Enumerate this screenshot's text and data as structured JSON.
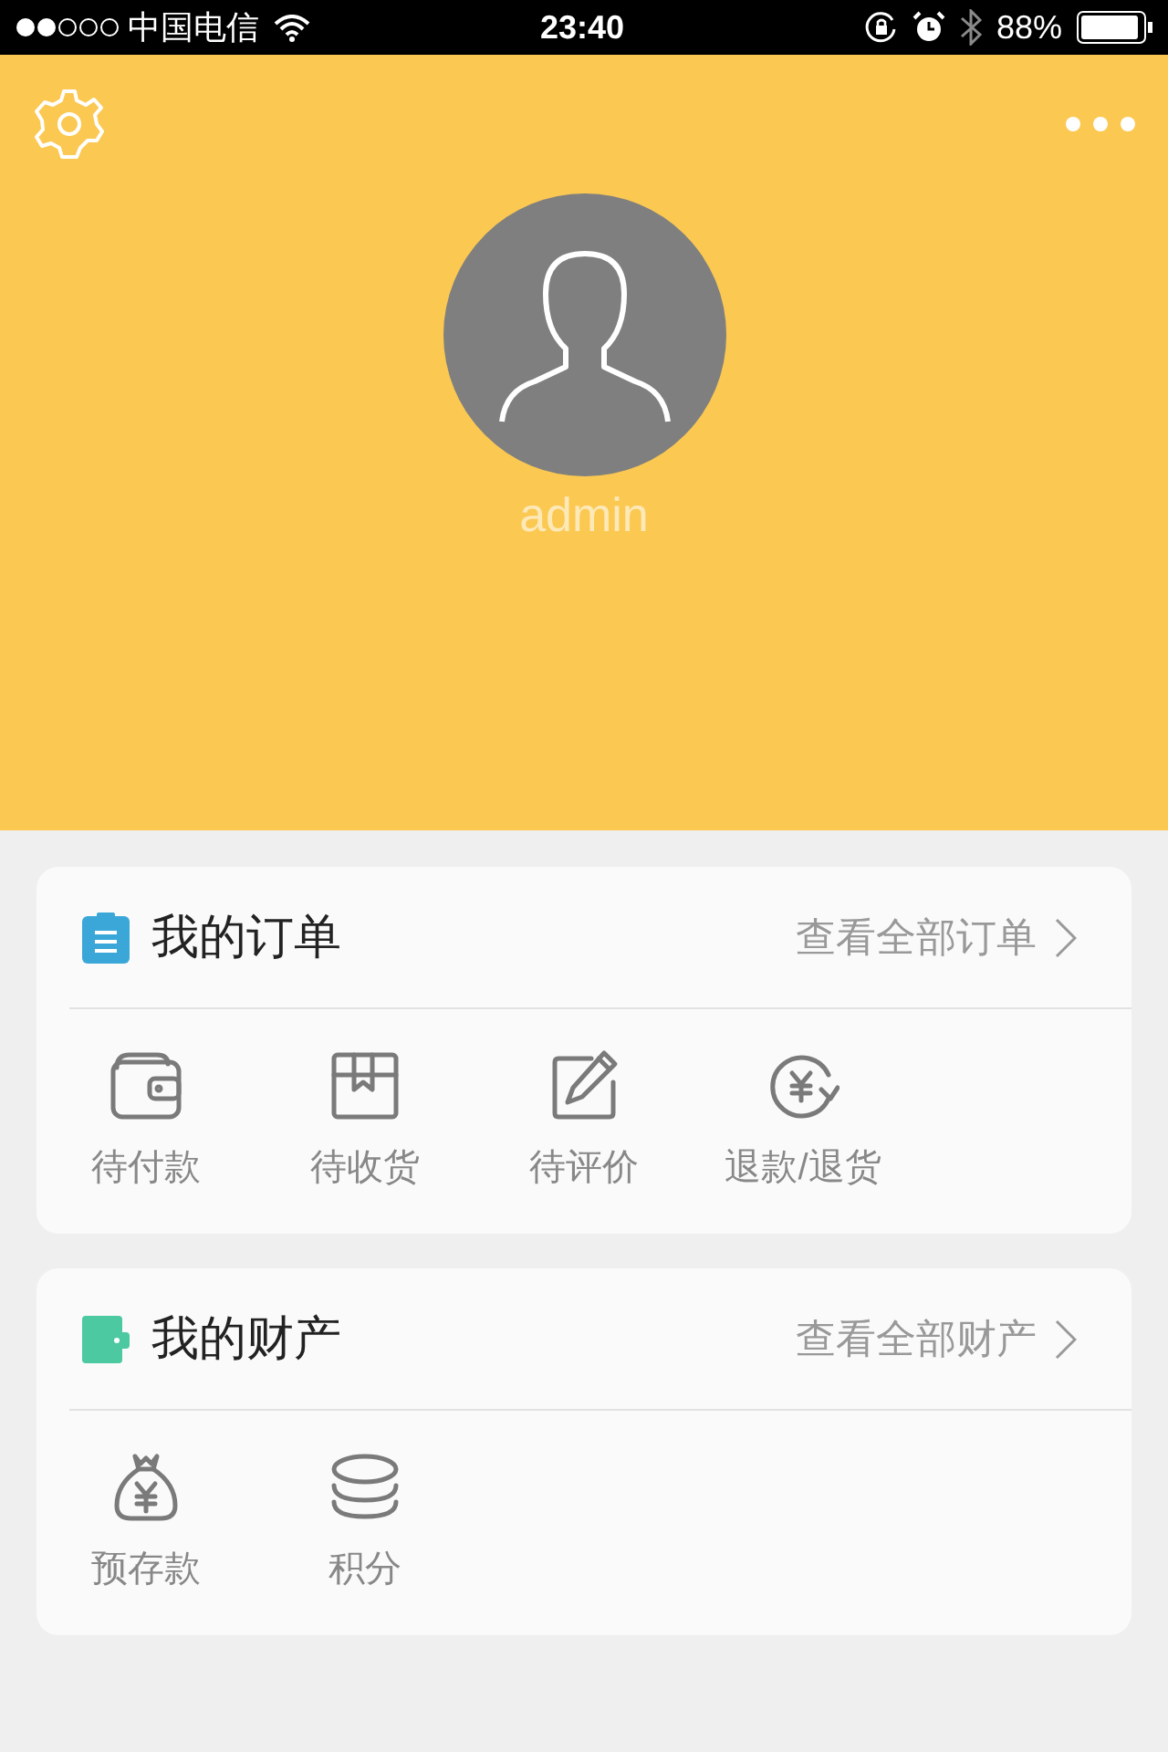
{
  "status_bar": {
    "carrier": "中国电信",
    "time": "23:40",
    "battery": "88%"
  },
  "profile": {
    "username": "admin"
  },
  "sections": [
    {
      "kind": "orders",
      "title": "我的订单",
      "color": "#3ba7d8",
      "link": "查看全部订单",
      "items": [
        {
          "kind": "wallet",
          "label": "待付款"
        },
        {
          "kind": "box",
          "label": "待收货"
        },
        {
          "kind": "edit",
          "label": "待评价"
        },
        {
          "kind": "refund",
          "label": "退款/退货"
        }
      ]
    },
    {
      "kind": "assets",
      "title": "我的财产",
      "color": "#4cc9a0",
      "link": "查看全部财产",
      "items": [
        {
          "kind": "moneybag",
          "label": "预存款"
        },
        {
          "kind": "coins",
          "label": "积分"
        }
      ]
    }
  ]
}
